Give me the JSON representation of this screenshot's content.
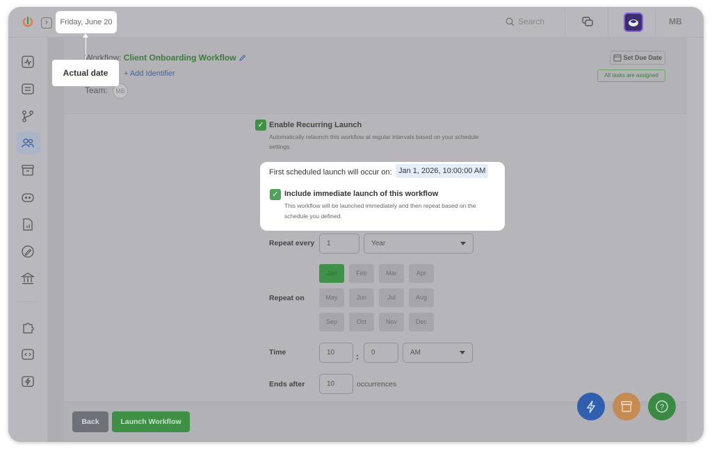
{
  "topbar": {
    "date": "Friday, June 20",
    "search_placeholder": "Search",
    "user_initials": "MB"
  },
  "tooltip": {
    "label": "Actual date"
  },
  "workflow": {
    "label_prefix": "Workflow:",
    "name": "Client Onboarding Workflow",
    "add_identifier": "+ Add Identifier",
    "team_label": "Team:",
    "team_member": "MB",
    "set_due_date": "Set Due Date",
    "assignment_status": "All tasks are assigned"
  },
  "recurring": {
    "enable_label": "Enable Recurring Launch",
    "enable_checked": true,
    "enable_desc": "Automatically relaunch this workflow at regular intervals based on your schedule settings.",
    "first_launch_label": "First scheduled launch will occur on:",
    "first_launch_value": "Jan 1, 2026, 10:00:00 AM",
    "include_label": "Include immediate launch of this workflow",
    "include_checked": true,
    "include_desc": "This workflow will be launched immediately and then repeat based on the schedule you defined.",
    "repeat_every_label": "Repeat every",
    "repeat_every_value": "1",
    "repeat_unit": "Year",
    "repeat_on_label": "Repeat on",
    "months": [
      "Jan",
      "Feb",
      "Mar",
      "Apr",
      "May",
      "Jun",
      "Jul",
      "Aug",
      "Sep",
      "Oct",
      "Nov",
      "Dec"
    ],
    "selected_month": "Jan",
    "time_label": "Time",
    "time_hour": "10",
    "time_separator": ":",
    "time_minute": "0",
    "time_period": "AM",
    "ends_after_label": "Ends after",
    "ends_after_value": "10",
    "occurrences_label": "occurrences"
  },
  "footer": {
    "back_label": "Back",
    "launch_label": "Launch Workflow"
  },
  "colors": {
    "accent_green": "#4fa05a",
    "fab_blue": "#2f6fd6",
    "fab_orange": "#e7a45c",
    "fab_green": "#3da84d"
  }
}
